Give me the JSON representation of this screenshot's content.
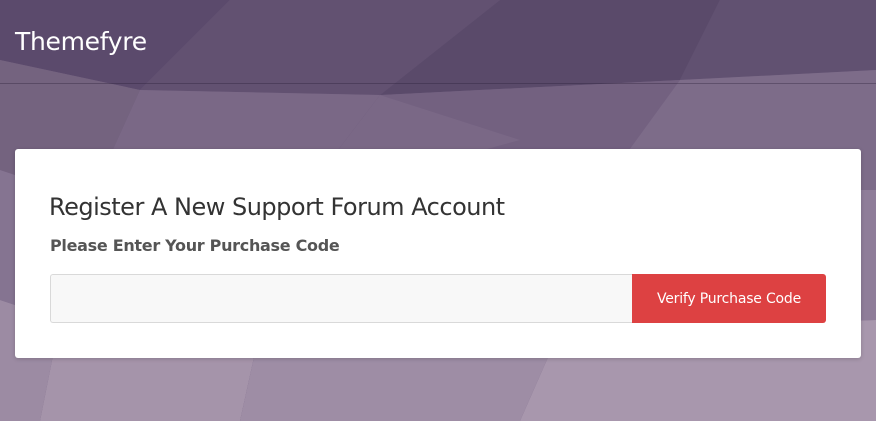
{
  "header": {
    "brand": "Themefyre"
  },
  "registration": {
    "title": "Register A New Support Forum Account",
    "field_label": "Please Enter Your Purchase Code",
    "purchase_code_value": "",
    "purchase_code_placeholder": "",
    "verify_button_label": "Verify Purchase Code"
  },
  "colors": {
    "accent_button": "#dd4142",
    "background": "#6f5d7e",
    "card": "#ffffff"
  }
}
